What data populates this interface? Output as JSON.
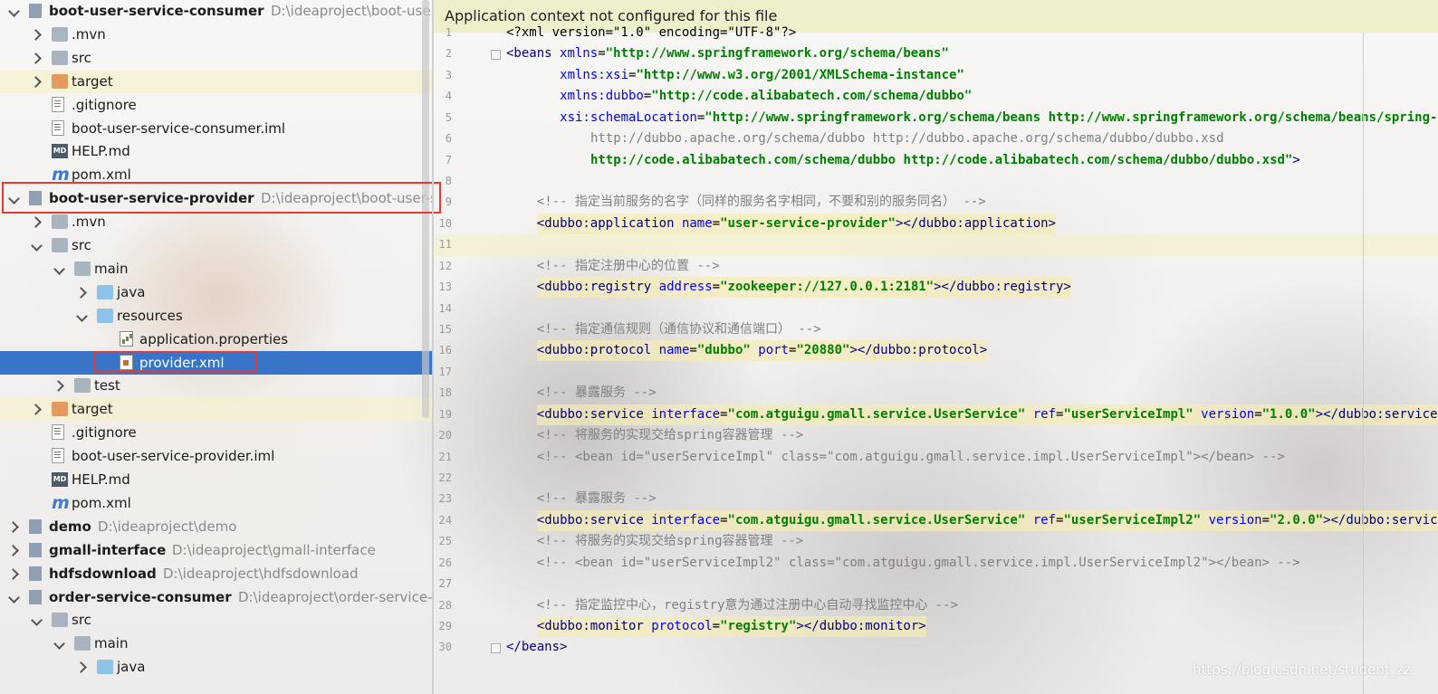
{
  "tree": {
    "rows": [
      {
        "label": "boot-user-service-consumer",
        "path": "D:\\ideaproject\\boot-user-se",
        "bold": true,
        "indent": 0,
        "arrow": "down",
        "icon": "module-icon"
      },
      {
        "label": ".mvn",
        "indent": 1,
        "arrow": "right",
        "icon": "folder-grey"
      },
      {
        "label": "src",
        "indent": 1,
        "arrow": "right",
        "icon": "folder-grey"
      },
      {
        "label": "target",
        "indent": 1,
        "arrow": "right",
        "icon": "folder-orange",
        "highlight": true
      },
      {
        "label": ".gitignore",
        "indent": 1,
        "icon": "file-icon"
      },
      {
        "label": "boot-user-service-consumer.iml",
        "indent": 1,
        "icon": "file-icon"
      },
      {
        "label": "HELP.md",
        "indent": 1,
        "icon": "md-icon"
      },
      {
        "label": "pom.xml",
        "indent": 1,
        "icon": "m-icon"
      },
      {
        "label": "boot-user-service-provider",
        "path": "D:\\ideaproject\\boot-user-serv",
        "bold": true,
        "indent": 0,
        "arrow": "down",
        "icon": "module-icon"
      },
      {
        "label": ".mvn",
        "indent": 1,
        "arrow": "right",
        "icon": "folder-grey"
      },
      {
        "label": "src",
        "indent": 1,
        "arrow": "down",
        "icon": "folder-grey"
      },
      {
        "label": "main",
        "indent": 2,
        "arrow": "down",
        "icon": "folder-grey"
      },
      {
        "label": "java",
        "indent": 3,
        "arrow": "right",
        "icon": "folder-blue"
      },
      {
        "label": "resources",
        "indent": 3,
        "arrow": "down",
        "icon": "folder-blue"
      },
      {
        "label": "application.properties",
        "indent": 4,
        "icon": "prop-icon"
      },
      {
        "label": "provider.xml",
        "indent": 4,
        "icon": "xml-icon",
        "selected": true
      },
      {
        "label": "test",
        "indent": 2,
        "arrow": "right",
        "icon": "folder-grey"
      },
      {
        "label": "target",
        "indent": 1,
        "arrow": "right",
        "icon": "folder-orange",
        "highlight": true
      },
      {
        "label": ".gitignore",
        "indent": 1,
        "icon": "file-icon"
      },
      {
        "label": "boot-user-service-provider.iml",
        "indent": 1,
        "icon": "file-icon"
      },
      {
        "label": "HELP.md",
        "indent": 1,
        "icon": "md-icon"
      },
      {
        "label": "pom.xml",
        "indent": 1,
        "icon": "m-icon"
      },
      {
        "label": "demo",
        "path": "D:\\ideaproject\\demo",
        "bold": true,
        "indent": 0,
        "arrow": "right",
        "icon": "module-icon"
      },
      {
        "label": "gmall-interface",
        "path": "D:\\ideaproject\\gmall-interface",
        "bold": true,
        "indent": 0,
        "arrow": "right",
        "icon": "module-icon"
      },
      {
        "label": "hdfsdownload",
        "path": "D:\\ideaproject\\hdfsdownload",
        "bold": true,
        "indent": 0,
        "arrow": "right",
        "icon": "module-icon"
      },
      {
        "label": "order-service-consumer",
        "path": "D:\\ideaproject\\order-service-con",
        "bold": true,
        "indent": 0,
        "arrow": "down",
        "icon": "module-icon"
      },
      {
        "label": "src",
        "indent": 1,
        "arrow": "down",
        "icon": "folder-grey"
      },
      {
        "label": "main",
        "indent": 2,
        "arrow": "down",
        "icon": "folder-grey"
      },
      {
        "label": "java",
        "indent": 3,
        "arrow": "right",
        "icon": "folder-blue"
      }
    ]
  },
  "editor": {
    "banner": "Application context not configured for this file",
    "lines": [
      {
        "n": "1",
        "indent": 0,
        "parts": [
          [
            "plain",
            "<?xml version=\"1.0\" encoding=\"UTF-8\"?>"
          ]
        ]
      },
      {
        "n": "2",
        "indent": 0,
        "parts": [
          [
            "tag",
            "<beans "
          ],
          [
            "attr",
            "xmlns"
          ],
          [
            "plain",
            "="
          ],
          [
            "val",
            "\"http://www.springframework.org/schema/beans\""
          ]
        ]
      },
      {
        "n": "3",
        "indent": 7,
        "parts": [
          [
            "attr",
            "xmlns:xsi"
          ],
          [
            "plain",
            "="
          ],
          [
            "val",
            "\"http://www.w3.org/2001/XMLSchema-instance\""
          ]
        ]
      },
      {
        "n": "4",
        "indent": 7,
        "parts": [
          [
            "attr",
            "xmlns:dubbo"
          ],
          [
            "plain",
            "="
          ],
          [
            "val",
            "\"http://code.alibabatech.com/schema/dubbo\""
          ]
        ]
      },
      {
        "n": "5",
        "indent": 7,
        "parts": [
          [
            "attr",
            "xsi:schemaLocation"
          ],
          [
            "plain",
            "="
          ],
          [
            "val",
            "\"http://www.springframework.org/schema/beans http://www.springframework.org/schema/beans/spring-beans.xsd"
          ]
        ]
      },
      {
        "n": "6",
        "indent": 11,
        "parts": [
          [
            "cmt",
            "http://dubbo.apache.org/schema/dubbo http://dubbo.apache.org/schema/dubbo/dubbo.xsd"
          ]
        ]
      },
      {
        "n": "7",
        "indent": 11,
        "parts": [
          [
            "val",
            "http://code.alibabatech.com/schema/dubbo http://code.alibabatech.com/schema/dubbo/dubbo.xsd\""
          ],
          [
            "tag",
            ">"
          ]
        ]
      },
      {
        "n": "8",
        "indent": 0,
        "parts": []
      },
      {
        "n": "9",
        "indent": 4,
        "parts": [
          [
            "cmt",
            "<!-- 指定当前服务的名字（同样的服务名字相同，不要和别的服务同名） -->"
          ]
        ]
      },
      {
        "n": "10",
        "indent": 4,
        "bg": true,
        "parts": [
          [
            "tag",
            "<dubbo:application "
          ],
          [
            "attr",
            "name"
          ],
          [
            "plain",
            "="
          ],
          [
            "val",
            "\"user-service-provider\""
          ],
          [
            "tag",
            "></dubbo:application>"
          ]
        ]
      },
      {
        "n": "11",
        "indent": 0,
        "cur": true,
        "parts": []
      },
      {
        "n": "12",
        "indent": 4,
        "parts": [
          [
            "cmt",
            "<!-- 指定注册中心的位置 -->"
          ]
        ]
      },
      {
        "n": "13",
        "indent": 4,
        "bg": true,
        "parts": [
          [
            "tag",
            "<dubbo:registry "
          ],
          [
            "attr",
            "address"
          ],
          [
            "plain",
            "="
          ],
          [
            "val",
            "\"zookeeper://127.0.0.1:2181\""
          ],
          [
            "tag",
            "></dubbo:registry>"
          ]
        ]
      },
      {
        "n": "14",
        "indent": 0,
        "parts": []
      },
      {
        "n": "15",
        "indent": 4,
        "parts": [
          [
            "cmt",
            "<!-- 指定通信规则（通信协议和通信端口） -->"
          ]
        ]
      },
      {
        "n": "16",
        "indent": 4,
        "bg": true,
        "parts": [
          [
            "tag",
            "<dubbo:protocol "
          ],
          [
            "attr",
            "name"
          ],
          [
            "plain",
            "="
          ],
          [
            "val",
            "\"dubbo\""
          ],
          [
            "plain",
            " "
          ],
          [
            "attr",
            "port"
          ],
          [
            "plain",
            "="
          ],
          [
            "val",
            "\"20880\""
          ],
          [
            "tag",
            "></dubbo:protocol>"
          ]
        ]
      },
      {
        "n": "17",
        "indent": 0,
        "parts": []
      },
      {
        "n": "18",
        "indent": 4,
        "parts": [
          [
            "cmt",
            "<!-- 暴露服务 -->"
          ]
        ]
      },
      {
        "n": "19",
        "indent": 4,
        "bg": true,
        "parts": [
          [
            "tag",
            "<dubbo:service "
          ],
          [
            "attr",
            "interface"
          ],
          [
            "plain",
            "="
          ],
          [
            "val",
            "\"com.atguigu.gmall.service.UserService\""
          ],
          [
            "plain",
            " "
          ],
          [
            "attr",
            "ref"
          ],
          [
            "plain",
            "="
          ],
          [
            "val",
            "\"userServiceImpl\""
          ],
          [
            "plain",
            " "
          ],
          [
            "attr",
            "version"
          ],
          [
            "plain",
            "="
          ],
          [
            "val",
            "\"1.0.0\""
          ],
          [
            "tag",
            "></dubbo:service>"
          ]
        ]
      },
      {
        "n": "20",
        "indent": 4,
        "parts": [
          [
            "cmt",
            "<!-- 将服务的实现交给spring容器管理 -->"
          ]
        ]
      },
      {
        "n": "21",
        "indent": 4,
        "parts": [
          [
            "cmt",
            "<!-- <bean id=\"userServiceImpl\" class=\"com.atguigu.gmall.service.impl.UserServiceImpl\"></bean> -->"
          ]
        ]
      },
      {
        "n": "22",
        "indent": 0,
        "parts": []
      },
      {
        "n": "23",
        "indent": 4,
        "parts": [
          [
            "cmt",
            "<!-- 暴露服务 -->"
          ]
        ]
      },
      {
        "n": "24",
        "indent": 4,
        "bg": true,
        "parts": [
          [
            "tag",
            "<dubbo:service "
          ],
          [
            "attr",
            "interface"
          ],
          [
            "plain",
            "="
          ],
          [
            "val",
            "\"com.atguigu.gmall.service.UserService\""
          ],
          [
            "plain",
            " "
          ],
          [
            "attr",
            "ref"
          ],
          [
            "plain",
            "="
          ],
          [
            "val",
            "\"userServiceImpl2\""
          ],
          [
            "plain",
            " "
          ],
          [
            "attr",
            "version"
          ],
          [
            "plain",
            "="
          ],
          [
            "val",
            "\"2.0.0\""
          ],
          [
            "tag",
            "></dubbo:service>"
          ]
        ]
      },
      {
        "n": "25",
        "indent": 4,
        "parts": [
          [
            "cmt",
            "<!-- 将服务的实现交给spring容器管理 -->"
          ]
        ]
      },
      {
        "n": "26",
        "indent": 4,
        "parts": [
          [
            "cmt",
            "<!-- <bean id=\"userServiceImpl2\" class=\"com.atguigu.gmall.service.impl.UserServiceImpl2\"></bean> -->"
          ]
        ]
      },
      {
        "n": "27",
        "indent": 0,
        "parts": []
      },
      {
        "n": "28",
        "indent": 4,
        "parts": [
          [
            "cmt",
            "<!-- 指定监控中心，registry意为通过注册中心自动寻找监控中心 -->"
          ]
        ]
      },
      {
        "n": "29",
        "indent": 4,
        "bg": true,
        "parts": [
          [
            "tag",
            "<dubbo:monitor "
          ],
          [
            "attr",
            "protocol"
          ],
          [
            "plain",
            "="
          ],
          [
            "val",
            "\"registry\""
          ],
          [
            "tag",
            "></dubbo:monitor>"
          ]
        ]
      },
      {
        "n": "30",
        "indent": 0,
        "parts": [
          [
            "tag",
            "</beans>"
          ]
        ]
      }
    ]
  },
  "watermark": "https://blog.csdn.net/student_zz"
}
